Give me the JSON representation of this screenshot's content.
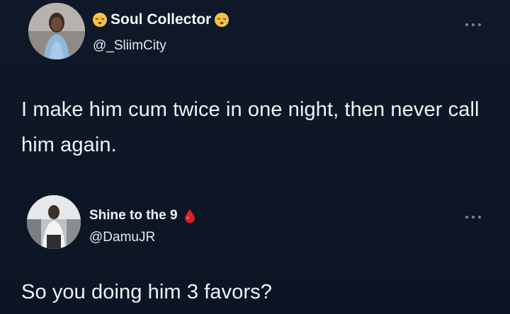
{
  "colors": {
    "background": "#0d1626",
    "text": "#f0f2f5",
    "muted_dots": "#7d8793"
  },
  "tweets": [
    {
      "display_name": "Soul Collector",
      "handle": "@_SliimCity",
      "name_emoji": "sleepy-face-emoji",
      "text": "I make him cum twice in one night, then never call him again."
    },
    {
      "display_name": "Shine to the 9",
      "handle": "@DamuJR",
      "name_emoji": "drop-of-blood-emoji",
      "text": "So you doing him 3 favors?"
    }
  ]
}
